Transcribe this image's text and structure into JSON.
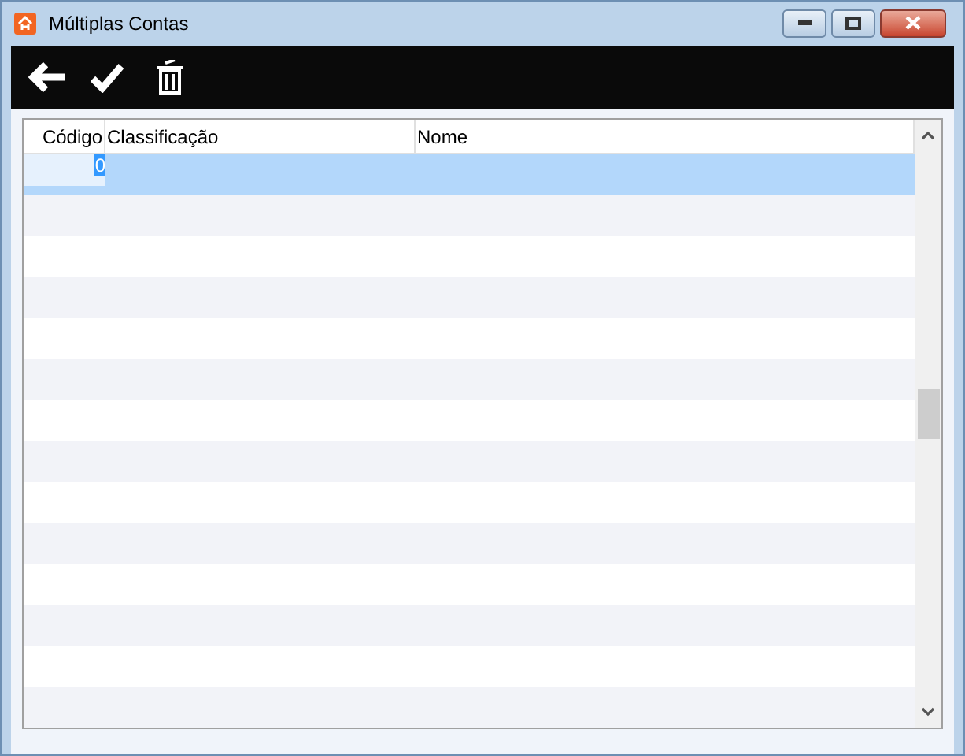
{
  "window": {
    "title": "Múltiplas Contas"
  },
  "table": {
    "columns": [
      "Código",
      "Classificação",
      "Nome"
    ],
    "rows": [
      {
        "cells": [
          "0",
          "",
          ""
        ],
        "selected": true
      }
    ]
  }
}
